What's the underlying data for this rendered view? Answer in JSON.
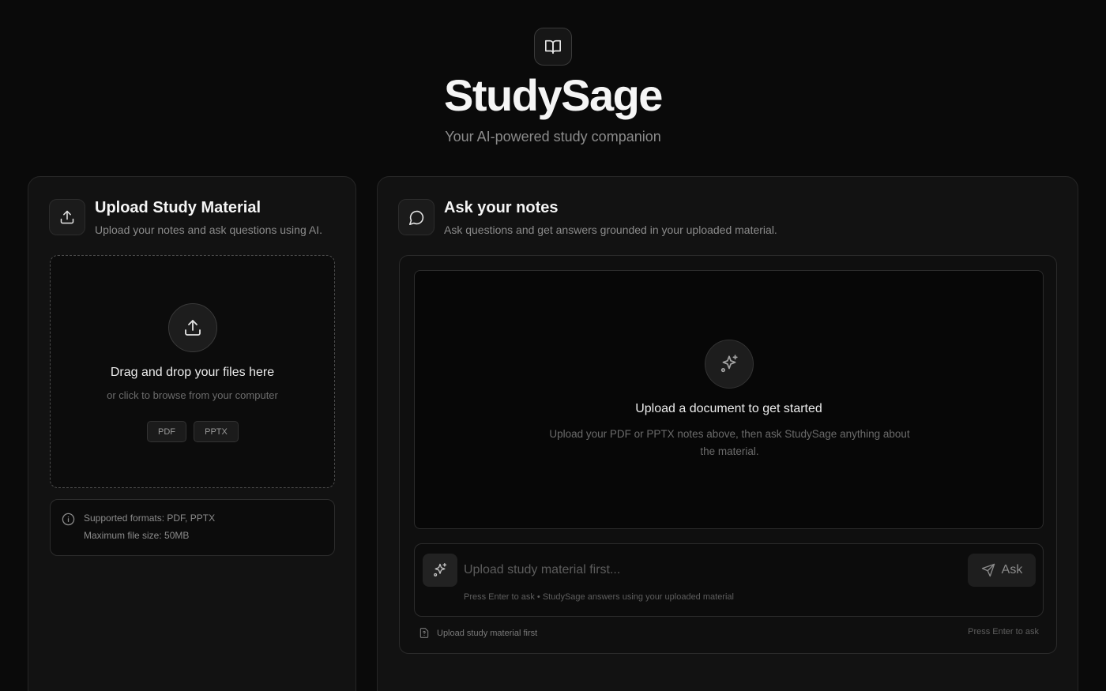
{
  "header": {
    "logo_icon": "book-open-icon",
    "title": "StudySage",
    "subtitle": "Your AI-powered study companion"
  },
  "upload_panel": {
    "icon": "upload-icon",
    "title": "Upload Study Material",
    "description": "Upload your notes and ask questions using AI.",
    "dropzone": {
      "icon": "upload-icon",
      "title": "Drag and drop your files here",
      "subtitle": "or click to browse from your computer",
      "formats": [
        "PDF",
        "PPTX"
      ]
    },
    "info": {
      "icon": "info-icon",
      "line1": "Supported formats: PDF, PPTX",
      "line2": "Maximum file size: 50MB"
    }
  },
  "ask_panel": {
    "icon": "message-circle-icon",
    "title": "Ask your notes",
    "description": "Ask questions and get answers grounded in your uploaded material.",
    "empty_state": {
      "icon": "sparkles-icon",
      "title": "Upload a document to get started",
      "description": "Upload your PDF or PPTX notes above, then ask StudySage anything about the material."
    },
    "composer": {
      "placeholder": "Upload study material first...",
      "value": "",
      "ask_label": "Ask",
      "hint": "Press Enter to ask • StudySage answers using your uploaded material"
    },
    "footer": {
      "status": "Upload study material first",
      "shortcut": "Press Enter to ask"
    }
  },
  "colors": {
    "background": "#0a0a0a",
    "panel": "#121212",
    "border": "#262626",
    "text_primary": "#f5f5f5",
    "text_muted": "#8b8b8b"
  }
}
